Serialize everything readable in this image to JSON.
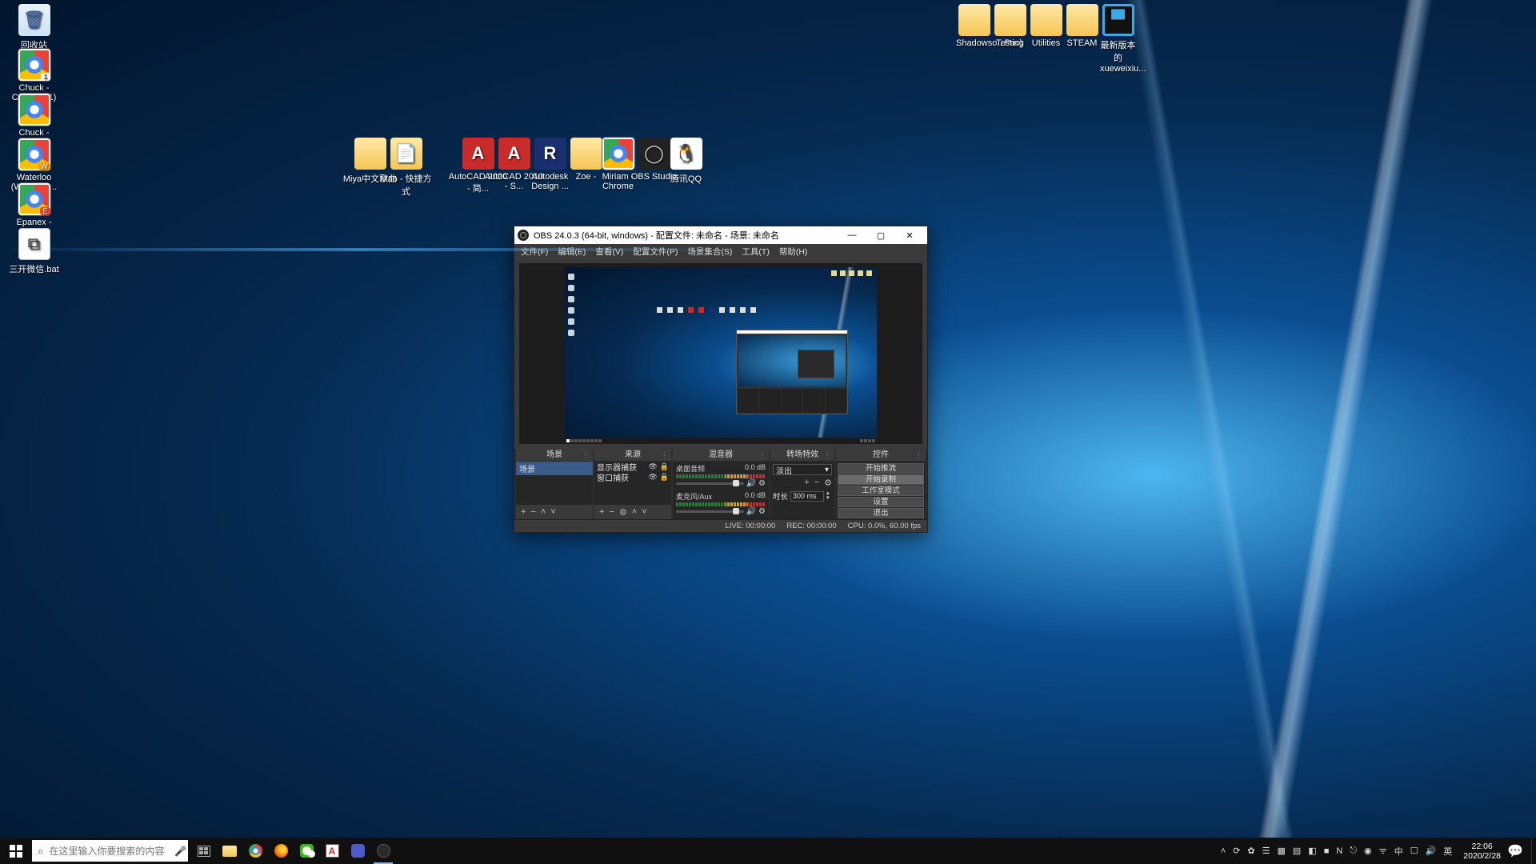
{
  "desktop": {
    "left_icons": [
      {
        "label": "回收站",
        "cls": "ico-bin",
        "glyph": "🗑"
      },
      {
        "label": "Chuck - Chrome (1)",
        "cls": "ico-chrome c1"
      },
      {
        "label": "Chuck - Chrome",
        "cls": "ico-chrome"
      },
      {
        "label": "Waterloo (WATERL...",
        "cls": "ico-chrome cw"
      },
      {
        "label": "Epanex - Chrome",
        "cls": "ico-chrome ce"
      },
      {
        "label": "三开微信.bat",
        "cls": "ico-bat",
        "glyph": "⧉"
      }
    ],
    "mid_icons": [
      {
        "label": "Miya中文歌曲",
        "cls": "ico-folder",
        "glyph": ""
      },
      {
        "label": "Mao - 快捷方式",
        "cls": "ico-folder",
        "glyph": "📄"
      },
      {
        "label": "AutoCAD 2020 - 简...",
        "cls": "ico-acad",
        "glyph": "A"
      },
      {
        "label": "AutoCAD 2010 - S...",
        "cls": "ico-acad",
        "glyph": "A"
      },
      {
        "label": "Autodesk Design ...",
        "cls": "ico-revit",
        "glyph": "R"
      },
      {
        "label": "Zoe -",
        "cls": "ico-folder",
        "glyph": ""
      },
      {
        "label": "Miriam - Chrome",
        "cls": "ico-chrome"
      },
      {
        "label": "OBS Studio",
        "cls": "ico-obs",
        "glyph": "◯"
      },
      {
        "label": "腾讯QQ",
        "cls": "ico-qq",
        "glyph": "🐧"
      }
    ],
    "right_icons": [
      {
        "label": "Shadowso...Pac)",
        "cls": "ico-folder"
      },
      {
        "label": "Testing",
        "cls": "ico-folder"
      },
      {
        "label": "Utilities",
        "cls": "ico-folder"
      },
      {
        "label": "STEAM",
        "cls": "ico-folder"
      },
      {
        "label": "最新版本的xueweixiu...",
        "cls": "ico-vid",
        "glyph": "▝▘"
      }
    ]
  },
  "obs": {
    "title": "OBS 24.0.3 (64-bit, windows) - 配置文件: 未命名 - 场景: 未命名",
    "menu": [
      "文件(F)",
      "编辑(E)",
      "查看(V)",
      "配置文件(P)",
      "场景集合(S)",
      "工具(T)",
      "帮助(H)"
    ],
    "panels": {
      "scenes": {
        "title": "场景",
        "items": [
          "场景"
        ]
      },
      "sources": {
        "title": "来源",
        "items": [
          "显示器捕获",
          "窗口捕获"
        ]
      },
      "mixer": {
        "title": "混音器",
        "channels": [
          {
            "name": "桌面音频",
            "level": "0.0 dB"
          },
          {
            "name": "麦克风/Aux",
            "level": "0.0 dB"
          }
        ]
      },
      "transitions": {
        "title": "转场特效",
        "selected": "淡出",
        "dur_label": "时长",
        "dur_value": "300 ms"
      },
      "controls": {
        "title": "控件",
        "buttons": [
          "开始推流",
          "开始录制",
          "工作室模式",
          "设置",
          "退出"
        ]
      }
    },
    "status": {
      "live": "LIVE: 00:00:00",
      "rec": "REC: 00:00:00",
      "cpu": "CPU: 0.0%, 60.00 fps"
    }
  },
  "taskbar": {
    "search_placeholder": "在这里输入你要搜索的内容",
    "clock_time": "22:06",
    "clock_date": "2020/2/28",
    "tray_glyphs": [
      "˄",
      "⟳",
      "✿",
      "☰",
      "▦",
      "▤",
      "◧",
      "■",
      "N",
      "⎋",
      "◉",
      "ᯤ",
      "中",
      "☐",
      "🔊",
      "英"
    ]
  }
}
